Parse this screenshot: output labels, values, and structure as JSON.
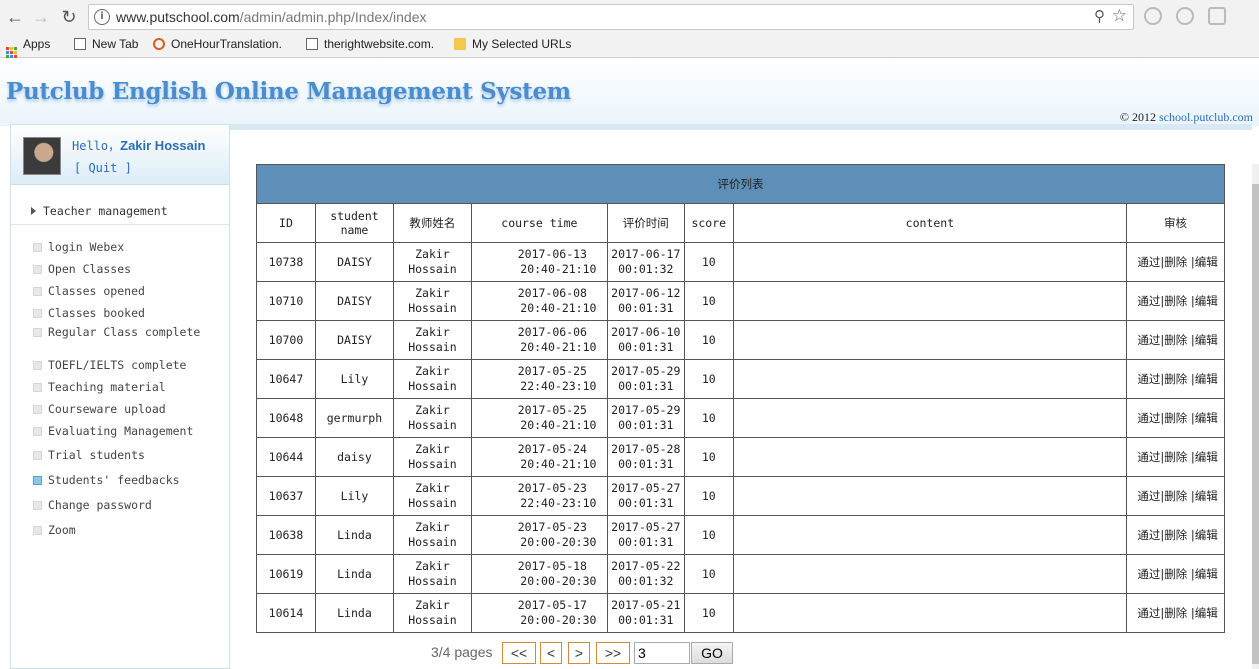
{
  "browser": {
    "url_host": "www.putschool.com",
    "url_path": "/admin/admin.php/Index/index",
    "bookmarks": [
      "Apps",
      "New Tab",
      "OneHourTranslation.",
      "therightwebsite.com.",
      "My Selected URLs"
    ]
  },
  "header": {
    "site_title": "Putclub English Online Management System",
    "copyright_prefix": "© 2012 ",
    "copyright_link": "school.putclub.com"
  },
  "sidebar": {
    "hello_prefix": "Hello，",
    "user_name": "Zakir Hossain",
    "quit_label": "[  Quit  ]",
    "section_label": "Teacher management",
    "items": [
      {
        "label": "login Webex"
      },
      {
        "label": "Open Classes"
      },
      {
        "label": "Classes opened"
      },
      {
        "label": "Classes booked"
      },
      {
        "label": "Regular Class complete"
      },
      {
        "label": "TOEFL/IELTS complete"
      },
      {
        "label": "Teaching material"
      },
      {
        "label": "Courseware upload"
      },
      {
        "label": "Evaluating Management"
      },
      {
        "label": "Trial students"
      },
      {
        "label": "Students' feedbacks",
        "active": true
      },
      {
        "label": "Change password"
      },
      {
        "label": "Zoom"
      }
    ]
  },
  "table": {
    "title": "评价列表",
    "headers": [
      "ID",
      "student name",
      "教师姓名",
      "course time",
      "评价时间",
      "score",
      "content",
      "审核"
    ],
    "rows": [
      {
        "id": "10738",
        "student": "DAISY",
        "teacher": "Zakir Hossain",
        "course_date": "2017-06-13",
        "course_slot": "20:40-21:10",
        "eval_date": "2017-06-17",
        "eval_time": "00:01:32",
        "score": "10",
        "content": ""
      },
      {
        "id": "10710",
        "student": "DAISY",
        "teacher": "Zakir Hossain",
        "course_date": "2017-06-08",
        "course_slot": "20:40-21:10",
        "eval_date": "2017-06-12",
        "eval_time": "00:01:31",
        "score": "10",
        "content": ""
      },
      {
        "id": "10700",
        "student": "DAISY",
        "teacher": "Zakir Hossain",
        "course_date": "2017-06-06",
        "course_slot": "20:40-21:10",
        "eval_date": "2017-06-10",
        "eval_time": "00:01:31",
        "score": "10",
        "content": ""
      },
      {
        "id": "10647",
        "student": "Lily",
        "teacher": "Zakir Hossain",
        "course_date": "2017-05-25",
        "course_slot": "22:40-23:10",
        "eval_date": "2017-05-29",
        "eval_time": "00:01:31",
        "score": "10",
        "content": ""
      },
      {
        "id": "10648",
        "student": "germurph",
        "teacher": "Zakir Hossain",
        "course_date": "2017-05-25",
        "course_slot": "20:40-21:10",
        "eval_date": "2017-05-29",
        "eval_time": "00:01:31",
        "score": "10",
        "content": ""
      },
      {
        "id": "10644",
        "student": "daisy",
        "teacher": "Zakir Hossain",
        "course_date": "2017-05-24",
        "course_slot": "20:40-21:10",
        "eval_date": "2017-05-28",
        "eval_time": "00:01:31",
        "score": "10",
        "content": ""
      },
      {
        "id": "10637",
        "student": "Lily",
        "teacher": "Zakir Hossain",
        "course_date": "2017-05-23",
        "course_slot": "22:40-23:10",
        "eval_date": "2017-05-27",
        "eval_time": "00:01:31",
        "score": "10",
        "content": ""
      },
      {
        "id": "10638",
        "student": "Linda",
        "teacher": "Zakir Hossain",
        "course_date": "2017-05-23",
        "course_slot": "20:00-20:30",
        "eval_date": "2017-05-27",
        "eval_time": "00:01:31",
        "score": "10",
        "content": ""
      },
      {
        "id": "10619",
        "student": "Linda",
        "teacher": "Zakir Hossain",
        "course_date": "2017-05-18",
        "course_slot": "20:00-20:30",
        "eval_date": "2017-05-22",
        "eval_time": "00:01:32",
        "score": "10",
        "content": ""
      },
      {
        "id": "10614",
        "student": "Linda",
        "teacher": "Zakir Hossain",
        "course_date": "2017-05-17",
        "course_slot": "20:00-20:30",
        "eval_date": "2017-05-21",
        "eval_time": "00:01:31",
        "score": "10",
        "content": ""
      }
    ],
    "actions": [
      "通过",
      "删除",
      "编辑"
    ]
  },
  "pager": {
    "info": "3/4 pages",
    "first": "<<",
    "prev": "<",
    "next": ">",
    "last": ">>",
    "page_value": "3",
    "go_label": "GO"
  }
}
